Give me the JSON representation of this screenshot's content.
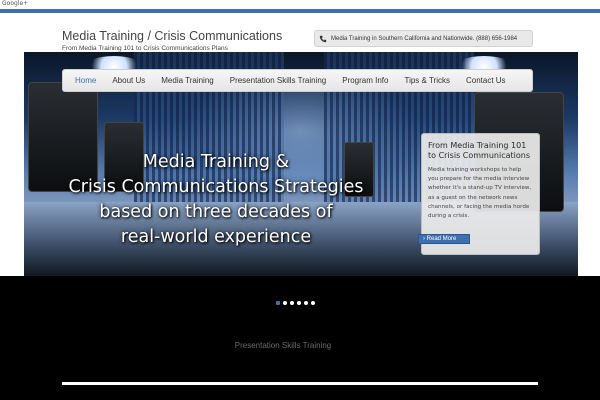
{
  "top_bar": {
    "label": "Google+"
  },
  "site": {
    "title": "Media Training / Crisis Communications",
    "tagline": "From Media Training 101 to Crisis Communications Plans"
  },
  "contact": {
    "phone_icon": "phone-icon",
    "text": "Media Training in Southern California and Nationwide. (888) 656-1984"
  },
  "nav": {
    "items": [
      {
        "label": "Home",
        "active": true
      },
      {
        "label": "About Us"
      },
      {
        "label": "Media Training"
      },
      {
        "label": "Presentation Skills Training"
      },
      {
        "label": "Program Info"
      },
      {
        "label": "Tips & Tricks"
      },
      {
        "label": "Contact Us"
      }
    ]
  },
  "hero": {
    "headline_lines": [
      "Media Training &",
      "Crisis Communications Strategies",
      "based on three decades of",
      "real-world experience"
    ]
  },
  "info_card": {
    "title": "From Media Training 101 to Crisis Communications",
    "body": "Media training workshops to help you prepare for the media interview whether it's a stand-up TV interview, as a guest on the network news channels, or facing the media horde during a crisis.",
    "button": "› Read More"
  },
  "slider": {
    "slide_count": 6,
    "active_index": 0
  },
  "bottom": {
    "link": "Presentation Skills Training"
  },
  "colors": {
    "accent": "#3f6fb0",
    "nav_bg": "#eeeeee",
    "bottom_bg": "#000000"
  }
}
